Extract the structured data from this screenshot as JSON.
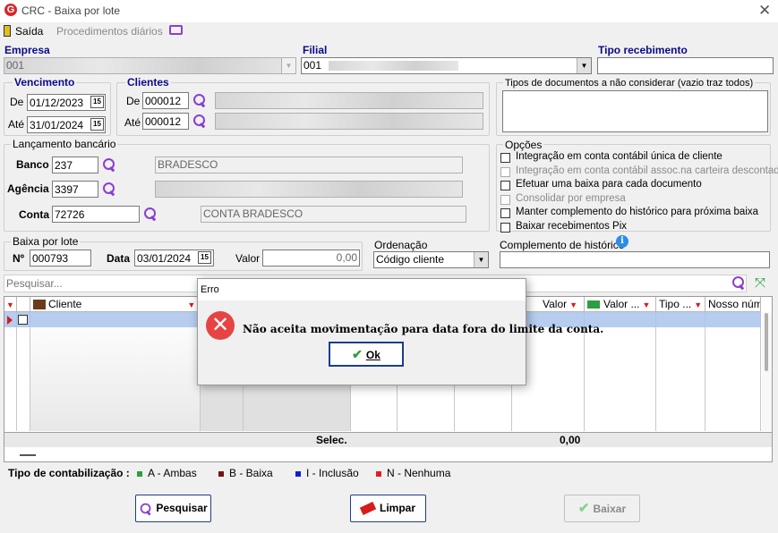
{
  "window": {
    "title": "CRC - Baixa por lote",
    "logo": "G"
  },
  "menu": {
    "exit": "Saída",
    "daily": "Procedimentos diários"
  },
  "empresa": {
    "label": "Empresa",
    "value": "001"
  },
  "filial": {
    "label": "Filial",
    "value": "001"
  },
  "tipo_recebimento": {
    "label": "Tipo recebimento",
    "value": ""
  },
  "vencimento": {
    "label": "Vencimento",
    "de_label": "De",
    "ate_label": "Até",
    "de": "01/12/2023",
    "ate": "31/01/2024"
  },
  "clientes": {
    "label": "Clientes",
    "de_label": "De",
    "ate_label": "Até",
    "de": "000012",
    "ate": "000012"
  },
  "tipos_doc": {
    "label": "Tipos de documentos a não considerar (vazio traz todos)"
  },
  "lancamento": {
    "label": "Lançamento bancário",
    "banco_label": "Banco",
    "banco": "237",
    "banco_nome": "BRADESCO",
    "agencia_label": "Agência",
    "agencia": "3397",
    "agencia_nome": "",
    "conta_label": "Conta",
    "conta": "72726",
    "conta_nome": "CONTA BRADESCO"
  },
  "opcoes": {
    "label": "Opções",
    "items": [
      {
        "label": "Integração em conta contábil única de cliente",
        "enabled": true
      },
      {
        "label": "Integração em conta contábil assoc.na carteira descontada",
        "enabled": false
      },
      {
        "label": "Efetuar uma baixa para cada documento",
        "enabled": true
      },
      {
        "label": "Consolidar por empresa",
        "enabled": false
      },
      {
        "label": "Manter complemento do histórico para próxima baixa",
        "enabled": true
      },
      {
        "label": "Baixar recebimentos Pix",
        "enabled": true
      }
    ]
  },
  "baixa_lote": {
    "label": "Baixa por lote",
    "num_label": "Nº",
    "num": "000793",
    "data_label": "Data",
    "data": "03/01/2024",
    "valor_label": "Valor",
    "valor": "0,00"
  },
  "ordenacao": {
    "label": "Ordenação",
    "value": "Código cliente"
  },
  "complemento": {
    "label": "Complemento de histórico",
    "value": ""
  },
  "search": {
    "placeholder": "Pesquisar..."
  },
  "grid": {
    "columns": [
      "Cliente",
      "Valor",
      "Valor ...",
      "Tipo ...",
      "Nosso núm"
    ],
    "footer_label": "Selec.",
    "footer_total": "0,00"
  },
  "legend": {
    "title": "Tipo de contabilização :",
    "items": [
      {
        "label": "A - Ambas",
        "color": "#2e9e3e"
      },
      {
        "label": "B - Baixa",
        "color": "#7a1010"
      },
      {
        "label": "I - Inclusão",
        "color": "#1020d0"
      },
      {
        "label": "N - Nenhuma",
        "color": "#e02020"
      }
    ]
  },
  "buttons": {
    "pesquisar": "Pesquisar",
    "limpar": "Limpar",
    "baixar": "Baixar"
  },
  "dialog": {
    "title": "Erro",
    "message": "Não aceita movimentação para data fora do limite da conta.",
    "ok": "Ok"
  }
}
